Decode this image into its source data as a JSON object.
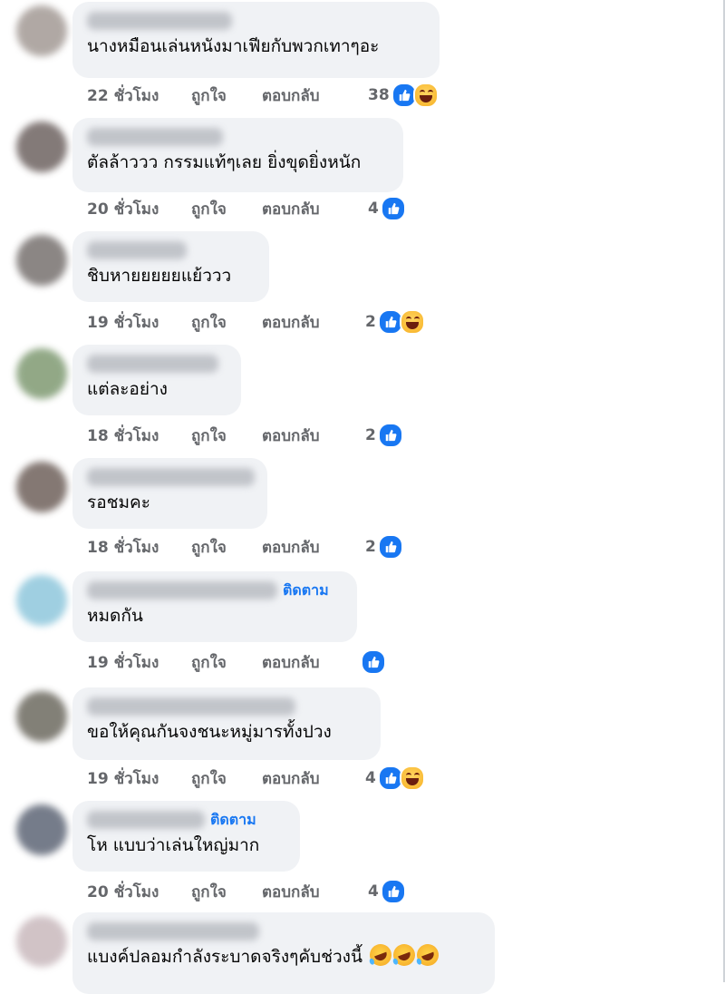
{
  "actions": {
    "like": "ถูกใจ",
    "reply": "ตอบกลับ"
  },
  "follow_label": "ติดตาม",
  "comments": [
    {
      "text": "นางหมือนเล่นหนังมาเฟียกับพวกเทาๆอะ",
      "time": "22 ชั่วโมง",
      "count": "38",
      "reactions": [
        "like-icon",
        "haha-icon"
      ],
      "follow": false
    },
    {
      "text": "ตัลล้าววว กรรมแท้ๆเลย ยิ่งขุดยิ่งหนัก",
      "time": "20 ชั่วโมง",
      "count": "4",
      "reactions": [
        "like-icon"
      ],
      "follow": false
    },
    {
      "text": "ชิบหายยยยยแย้ววว",
      "time": "19 ชั่วโมง",
      "count": "2",
      "reactions": [
        "like-icon",
        "haha-icon"
      ],
      "follow": false
    },
    {
      "text": "แต่ละอย่าง",
      "time": "18 ชั่วโมง",
      "count": "2",
      "reactions": [
        "like-icon"
      ],
      "follow": false
    },
    {
      "text": "รอชมคะ",
      "time": "18 ชั่วโมง",
      "count": "2",
      "reactions": [
        "like-icon"
      ],
      "follow": false
    },
    {
      "text": "หมดกัน",
      "time": "19 ชั่วโมง",
      "count": "",
      "reactions": [
        "like-icon"
      ],
      "follow": true
    },
    {
      "text": "ขอให้คุณกันจงชนะหมู่มารทั้งปวง",
      "time": "19 ชั่วโมง",
      "count": "4",
      "reactions": [
        "like-icon",
        "haha-icon"
      ],
      "follow": false
    },
    {
      "text": "โห แบบว่าเล่นใหญ่มาก",
      "time": "20 ชั่วโมง",
      "count": "4",
      "reactions": [
        "like-icon"
      ],
      "follow": true
    },
    {
      "text": "แบงค์ปลอมกำลังระบาดจริงๆคับช่วงนี้",
      "time": "",
      "count": "",
      "reactions": [],
      "follow": false,
      "emoji": [
        "rolling-laughing-emoji",
        "rolling-laughing-emoji",
        "rolling-laughing-emoji"
      ]
    }
  ]
}
